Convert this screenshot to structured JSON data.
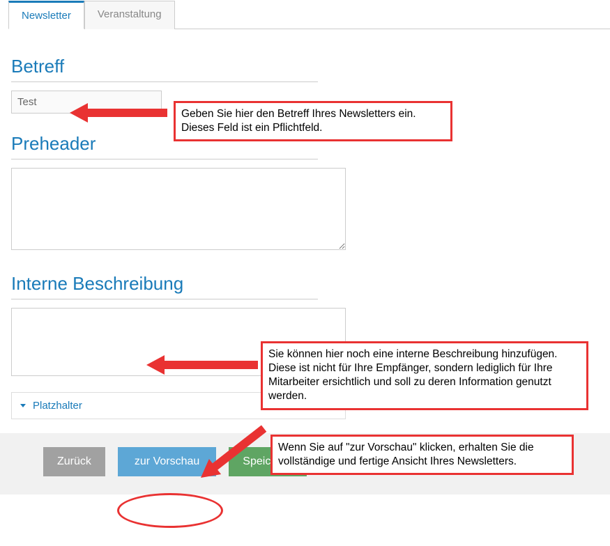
{
  "tabs": {
    "newsletter": "Newsletter",
    "veranstaltung": "Veranstaltung"
  },
  "sections": {
    "betreff": {
      "heading": "Betreff",
      "value": "Test"
    },
    "preheader": {
      "heading": "Preheader",
      "value": ""
    },
    "interne": {
      "heading": "Interne Beschreibung",
      "value": ""
    }
  },
  "placeholder_toggle": "Platzhalter",
  "buttons": {
    "back": "Zurück",
    "preview": "zur Vorschau",
    "save": "Speichern"
  },
  "callouts": {
    "betreff": "Geben Sie hier den Betreff Ihres Newsletters ein. Dieses Feld ist ein Pflichtfeld.",
    "interne": "Sie können hier noch eine interne Beschreibung hinzufügen. Diese ist nicht für Ihre Empfänger, sondern lediglich für Ihre Mitarbeiter ersichtlich und soll zu deren Information genutzt werden.",
    "preview": "Wenn Sie auf \"zur Vorschau\" klicken, erhalten Sie die vollständige und fertige Ansicht Ihres Newsletters."
  }
}
